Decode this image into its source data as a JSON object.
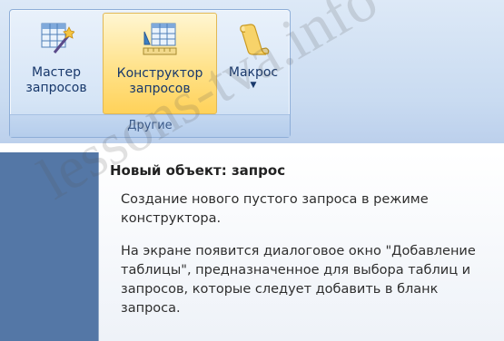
{
  "ribbon": {
    "group_label": "Другие",
    "buttons": [
      {
        "label1": "Мастер",
        "label2": "запросов",
        "icon": "query-wizard-icon"
      },
      {
        "label1": "Конструктор",
        "label2": "запросов",
        "icon": "query-design-icon",
        "highlighted": true
      },
      {
        "label1": "Макрос",
        "icon": "macro-scroll-icon",
        "dropdown": true
      }
    ]
  },
  "tooltip": {
    "title": "Новый объект: запрос",
    "paragraph1": "Создание нового пустого запроса в режиме конструктора.",
    "paragraph2": "На экране появится диалоговое окно \"Добавление таблицы\", предназначенное для выбора таблиц и запросов, которые следует добавить в бланк запроса."
  },
  "watermark": "lessons-tva.info",
  "colors": {
    "ribbon_bg": "#c9dbf1",
    "highlight": "#ffd25a",
    "tooltip_backdrop": "#5477a6"
  }
}
